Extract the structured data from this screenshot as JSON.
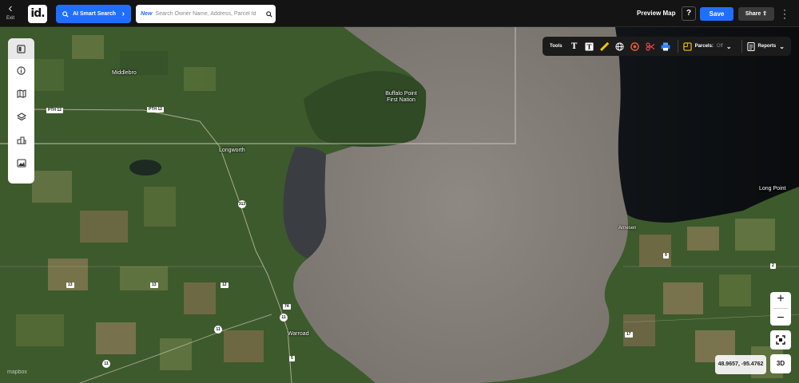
{
  "header": {
    "exit_label": "Exit",
    "logo_text": "id.",
    "ai_search_label": "AI Smart Search",
    "search": {
      "new_tag": "New",
      "placeholder": "Search Owner Name, Address, Parcel Id"
    },
    "preview_label": "Preview Map",
    "help_label": "?",
    "save_label": "Save",
    "share_label": "Share"
  },
  "toolbar": {
    "tools_label": "Tools",
    "parcels_label": "Parcels:",
    "parcels_state": "Off",
    "reports_label": "Reports"
  },
  "map": {
    "places": {
      "middlebro": "Middlebro",
      "buffalo_point": "Buffalo Point\nFirst Nation",
      "longworth": "Longworth",
      "long_point": "Long Point",
      "arnesen": "Arnesen",
      "warroad": "Warroad"
    },
    "shields": {
      "pth12_a": "PTH 12",
      "pth12_b": "PTH 12",
      "r313": "313",
      "r11_a": "11",
      "r11_b": "11",
      "r11_c": "11",
      "r74": "74",
      "r5": "5",
      "r13": "13",
      "r12": "12",
      "r17": "17",
      "r9": "9",
      "r2": "2",
      "r13b": "13"
    },
    "coords": "48.9657, -95.4762",
    "attribution": "mapbox"
  },
  "controls": {
    "zoom_in": "+",
    "zoom_out": "−",
    "btn_3d": "3D"
  },
  "colors": {
    "accent": "#1f6fff",
    "topbar": "#141414",
    "water": "#8a8580",
    "land": "#3e5a2e"
  }
}
